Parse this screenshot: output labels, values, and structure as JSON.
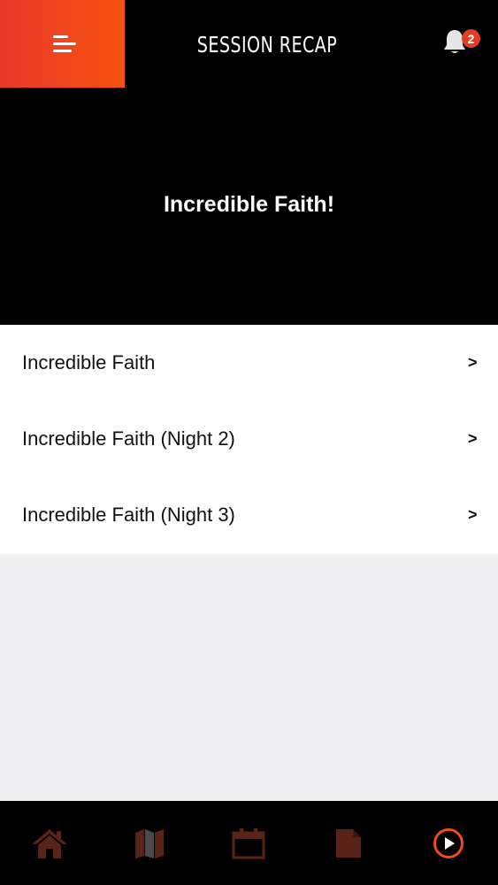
{
  "header": {
    "title": "SESSION RECAP",
    "menu_icon": "hamburger-icon",
    "notification_icon": "bell-icon",
    "notification_count": "2",
    "accent_color": "#f24a1a"
  },
  "hero": {
    "title": "Incredible Faith!"
  },
  "sessions": [
    {
      "label": "Incredible Faith",
      "chevron": ">"
    },
    {
      "label": "Incredible Faith (Night 2)",
      "chevron": ">"
    },
    {
      "label": "Incredible Faith (Night 3)",
      "chevron": ">"
    }
  ],
  "bottom_nav": [
    {
      "icon": "home-icon"
    },
    {
      "icon": "map-icon"
    },
    {
      "icon": "calendar-icon"
    },
    {
      "icon": "document-icon"
    },
    {
      "icon": "play-icon",
      "active": true
    }
  ]
}
